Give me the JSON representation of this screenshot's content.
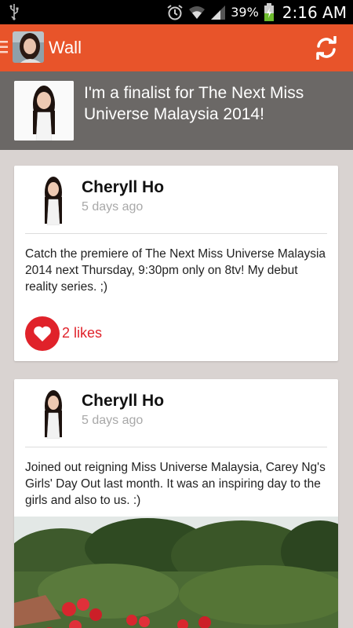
{
  "status_bar": {
    "battery_percent": "39%",
    "time": "2:16 AM",
    "icons": [
      "usb-icon",
      "alarm-icon",
      "wifi-icon",
      "signal-icon",
      "battery-charging-icon"
    ]
  },
  "action_bar": {
    "title": "Wall",
    "color": "#e8542a",
    "icons": [
      "menu-icon",
      "refresh-icon"
    ]
  },
  "banner": {
    "text": "I'm a finalist for The Next Miss Universe Malaysia 2014!"
  },
  "posts": [
    {
      "author": "Cheryll Ho",
      "time": "5 days ago",
      "text": "Catch the premiere of The Next Miss Universe Malaysia 2014 next Thursday, 9:30pm only on 8tv! My debut reality series. ;)",
      "likes": "2 likes"
    },
    {
      "author": "Cheryll Ho",
      "time": "5 days ago",
      "text": "Joined out reigning Miss Universe Malaysia, Carey Ng's Girls' Day Out last month. It was an inspiring day to the girls and also to us. :)"
    }
  ],
  "accent_colors": {
    "like": "#e0222a",
    "banner_bg": "#6b6866",
    "page_bg": "#d9d3d1"
  }
}
